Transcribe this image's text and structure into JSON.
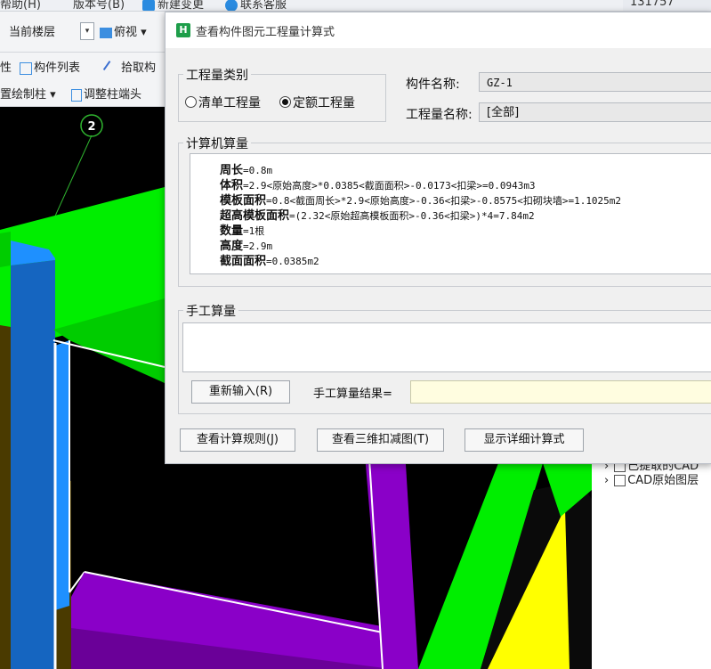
{
  "menubar": {
    "help": "帮助(H)",
    "version": "版本号(B)",
    "new_change": "新建变更",
    "contact": "联系客服",
    "account": "131757"
  },
  "toolbar": {
    "current_floor": "当前楼层",
    "view": "俯视",
    "props_fragment": "性",
    "component_list": "构件列表",
    "pick_fragment": "拾取构",
    "draw_column_fragment": "置绘制柱",
    "adjust_column_end": "调整柱端头"
  },
  "canvas": {
    "axis_label": "2"
  },
  "right_panel": {
    "row1": "已提取的CAD",
    "row2": "CAD原始图层"
  },
  "dialog": {
    "title": "查看构件图元工程量计算式",
    "quantity_type": {
      "label": "工程量类别",
      "options": [
        "清单工程量",
        "定额工程量"
      ],
      "selected": 1
    },
    "component_name_label": "构件名称:",
    "component_name_value": "GZ-1",
    "quantity_name_label": "工程量名称:",
    "quantity_name_value": "[全部]",
    "computer_calc": {
      "label": "计算机算量",
      "lines": [
        {
          "name": "周长",
          "formula": "=0.8m"
        },
        {
          "name": "体积",
          "formula": "=2.9<原始高度>*0.0385<截面面积>-0.0173<扣梁>=0.0943m3"
        },
        {
          "name": "模板面积",
          "formula": "=0.8<截面周长>*2.9<原始高度>-0.36<扣梁>-0.8575<扣砌块墙>=1.1025m2"
        },
        {
          "name": "超高模板面积",
          "formula": "=(2.32<原始超高模板面积>-0.36<扣梁>)*4=7.84m2"
        },
        {
          "name": "数量",
          "formula": "=1根"
        },
        {
          "name": "高度",
          "formula": "=2.9m"
        },
        {
          "name": "截面面积",
          "formula": "=0.0385m2"
        }
      ]
    },
    "manual_calc": {
      "label": "手工算量",
      "reenter_button": "重新输入(R)",
      "result_label": "手工算量结果=",
      "result_value": ""
    },
    "buttons": {
      "view_rules": "查看计算规则(J)",
      "view_3d": "查看三维扣减图(T)",
      "show_detail": "显示详细计算式"
    }
  },
  "colors": {
    "green": "#00ee00",
    "blue": "#1e90ff",
    "purple": "#8a00c8",
    "yellow": "#ffff00",
    "olive": "#4a3a00"
  }
}
